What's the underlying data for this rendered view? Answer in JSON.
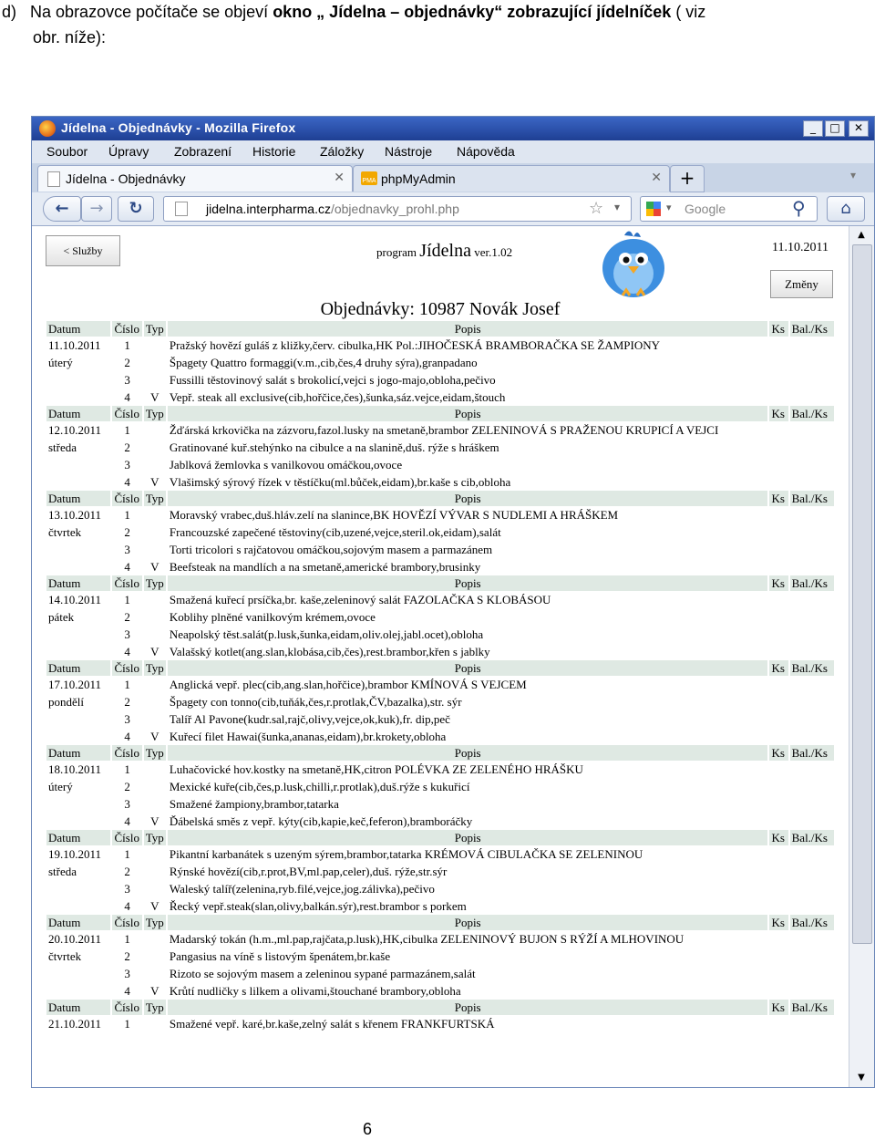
{
  "intro": {
    "prefix": "d)",
    "line1_plain": "Na obrazovce počítače se objeví ",
    "line1_bold": "okno „ Jídelna – objednávky“  zobrazující jídelníček",
    "line1_tail": " ( viz",
    "line2": "obr. níže):"
  },
  "window": {
    "title": "Jídelna - Objednávky - Mozilla Firefox",
    "controls": [
      "_",
      "□",
      "✕"
    ]
  },
  "menubar": [
    "Soubor",
    "Úpravy",
    "Zobrazení",
    "Historie",
    "Záložky",
    "Nástroje",
    "Nápověda"
  ],
  "tabs": [
    {
      "label": "Jídelna - Objednávky",
      "close": "✕"
    },
    {
      "label": "phpMyAdmin",
      "close": "✕"
    }
  ],
  "newtab": "+",
  "nav": {
    "back": "←",
    "forward": "→",
    "reload": "↻",
    "home": "⌂",
    "url_host": "jidelna.interpharma.cz",
    "url_path": "/objednavky_prohl.php",
    "search_placeholder": "Google",
    "star": "☆",
    "dropdown": "▾",
    "search_icon": "⚲"
  },
  "page": {
    "back_button": "< Služby",
    "program_prefix": "program ",
    "program_name": "Jídelna",
    "program_version": " ver.1.02",
    "date": "11.10.2011",
    "changes_button": "Změny",
    "heading": "Objednávky: 10987 Novák Josef"
  },
  "table": {
    "headers": {
      "date": "Datum",
      "num": "Číslo",
      "type": "Typ",
      "desc": "Popis",
      "ks": "Ks",
      "bal": "Bal./Ks"
    },
    "days": [
      {
        "date": "11.10.2011",
        "weekday": "úterý",
        "items": [
          {
            "num": "1",
            "type": "",
            "desc": "Pražský hovězí guláš z kližky,červ. cibulka,HK Pol.:JIHOČESKÁ BRAMBORAČKA SE ŽAMPIONY"
          },
          {
            "num": "2",
            "type": "",
            "desc": "Špagety Quattro formaggi(v.m.,cib,čes,4 druhy sýra),granpadano"
          },
          {
            "num": "3",
            "type": "",
            "desc": "Fussilli těstovinový salát s brokolicí,vejci s jogo-majo,obloha,pečivo"
          },
          {
            "num": "4",
            "type": "V",
            "desc": "Vepř. steak all exclusive(cib,hořčice,čes),šunka,sáz.vejce,eidam,štouch"
          }
        ]
      },
      {
        "date": "12.10.2011",
        "weekday": "středa",
        "items": [
          {
            "num": "1",
            "type": "",
            "desc": "Žďárská krkovička na zázvoru,fazol.lusky na smetaně,brambor ZELENINOVÁ S PRAŽENOU KRUPICÍ A VEJCI"
          },
          {
            "num": "2",
            "type": "",
            "desc": "Gratinované kuř.stehýnko na cibulce a na slanině,duš. rýže s hráškem"
          },
          {
            "num": "3",
            "type": "",
            "desc": "Jablková žemlovka s vanilkovou omáčkou,ovoce"
          },
          {
            "num": "4",
            "type": "V",
            "desc": "Vlašimský sýrový řízek v těstíčku(ml.bůček,eidam),br.kaše s cib,obloha"
          }
        ]
      },
      {
        "date": "13.10.2011",
        "weekday": "čtvrtek",
        "items": [
          {
            "num": "1",
            "type": "",
            "desc": "Moravský vrabec,duš.hláv.zelí na slanince,BK HOVĚZÍ VÝVAR S NUDLEMI A HRÁŠKEM"
          },
          {
            "num": "2",
            "type": "",
            "desc": "Francouzské zapečené těstoviny(cib,uzené,vejce,steril.ok,eidam),salát"
          },
          {
            "num": "3",
            "type": "",
            "desc": "Torti tricolori s rajčatovou omáčkou,sojovým masem a parmazánem"
          },
          {
            "num": "4",
            "type": "V",
            "desc": "Beefsteak na mandlích a na smetaně,americké brambory,brusinky"
          }
        ]
      },
      {
        "date": "14.10.2011",
        "weekday": "pátek",
        "items": [
          {
            "num": "1",
            "type": "",
            "desc": "Smažená kuřecí prsíčka,br. kaše,zeleninový salát FAZOLAČKA S KLOBÁSOU"
          },
          {
            "num": "2",
            "type": "",
            "desc": "Koblihy plněné vanilkovým krémem,ovoce"
          },
          {
            "num": "3",
            "type": "",
            "desc": "Neapolský těst.salát(p.lusk,šunka,eidam,oliv.olej,jabl.ocet),obloha"
          },
          {
            "num": "4",
            "type": "V",
            "desc": "Valašský kotlet(ang.slan,klobása,cib,čes),rest.brambor,křen s jablky"
          }
        ]
      },
      {
        "date": "17.10.2011",
        "weekday": "pondělí",
        "items": [
          {
            "num": "1",
            "type": "",
            "desc": "Anglická vepř. plec(cib,ang.slan,hořčice),brambor KMÍNOVÁ S VEJCEM"
          },
          {
            "num": "2",
            "type": "",
            "desc": "Špagety con tonno(cib,tuňák,čes,r.protlak,ČV,bazalka),str. sýr"
          },
          {
            "num": "3",
            "type": "",
            "desc": "Talíř Al Pavone(kudr.sal,rajč,olivy,vejce,ok,kuk),fr. dip,peč"
          },
          {
            "num": "4",
            "type": "V",
            "desc": "Kuřecí filet Hawai(šunka,ananas,eidam),br.krokety,obloha"
          }
        ]
      },
      {
        "date": "18.10.2011",
        "weekday": "úterý",
        "items": [
          {
            "num": "1",
            "type": "",
            "desc": "Luhačovické hov.kostky na smetaně,HK,citron POLÉVKA ZE ZELENÉHO HRÁŠKU"
          },
          {
            "num": "2",
            "type": "",
            "desc": "Mexické kuře(cib,čes,p.lusk,chilli,r.protlak),duš.rýže s kukuřicí"
          },
          {
            "num": "3",
            "type": "",
            "desc": "Smažené žampiony,brambor,tatarka"
          },
          {
            "num": "4",
            "type": "V",
            "desc": "Ďábelská směs z vepř. kýty(cib,kapie,keč,feferon),bramboráčky"
          }
        ]
      },
      {
        "date": "19.10.2011",
        "weekday": "středa",
        "items": [
          {
            "num": "1",
            "type": "",
            "desc": "Pikantní karbanátek s uzeným sýrem,brambor,tatarka KRÉMOVÁ CIBULAČKA SE ZELENINOU"
          },
          {
            "num": "2",
            "type": "",
            "desc": "Rýnské hovězí(cib,r.prot,BV,ml.pap,celer),duš. rýže,str.sýr"
          },
          {
            "num": "3",
            "type": "",
            "desc": "Waleský talíř(zelenina,ryb.filé,vejce,jog.zálivka),pečivo"
          },
          {
            "num": "4",
            "type": "V",
            "desc": "Řecký vepř.steak(slan,olivy,balkán.sýr),rest.brambor s porkem"
          }
        ]
      },
      {
        "date": "20.10.2011",
        "weekday": "čtvrtek",
        "items": [
          {
            "num": "1",
            "type": "",
            "desc": "Madarský tokán (h.m.,ml.pap,rajčata,p.lusk),HK,cibulka ZELENINOVÝ BUJON S RÝŽÍ A MLHOVINOU"
          },
          {
            "num": "2",
            "type": "",
            "desc": "Pangasius na víně s listovým špenátem,br.kaše"
          },
          {
            "num": "3",
            "type": "",
            "desc": "Rizoto se sojovým masem a zeleninou sypané parmazánem,salát"
          },
          {
            "num": "4",
            "type": "V",
            "desc": "Krůtí nudličky s lilkem a olivami,štouchané brambory,obloha"
          }
        ]
      },
      {
        "date": "21.10.2011",
        "weekday": "",
        "items": [
          {
            "num": "1",
            "type": "",
            "desc": "Smažené vepř. karé,br.kaše,zelný salát s křenem FRANKFURTSKÁ"
          }
        ]
      }
    ]
  },
  "scrollbar": {
    "up": "▲",
    "down": "▼"
  },
  "page_number": "6",
  "colors": {
    "header_row": "#dfe9e3",
    "titlebar": "#2a4fa8",
    "bird": "#3d8fe0"
  }
}
